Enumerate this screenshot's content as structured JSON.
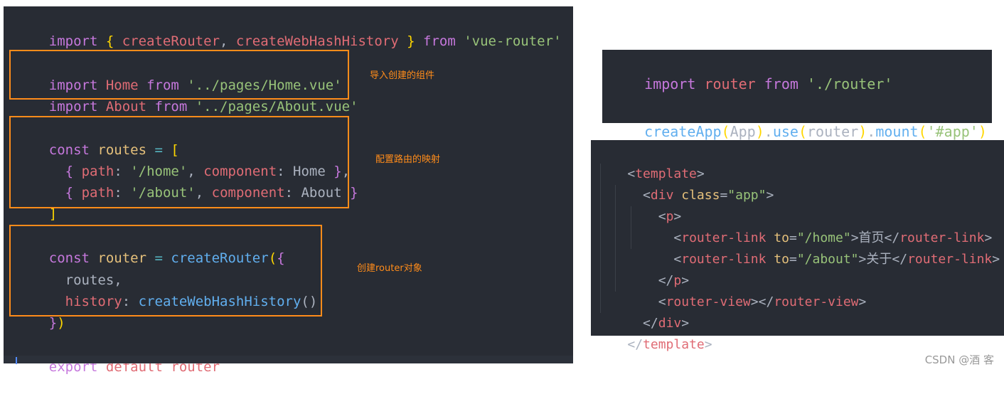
{
  "router_file": {
    "lines": {
      "import_vue_router": [
        "import",
        " { ",
        "createRouter",
        ", ",
        "createWebHashHistory",
        " } ",
        "from",
        " ",
        "'vue-router'"
      ],
      "import_home": [
        "import",
        " ",
        "Home",
        " ",
        "from",
        " ",
        "'../pages/Home.vue'"
      ],
      "import_about": [
        "import",
        " ",
        "About",
        " ",
        "from",
        " ",
        "'../pages/About.vue'"
      ],
      "routes_open": [
        "const",
        " ",
        "routes",
        " ",
        "=",
        " ",
        "["
      ],
      "route_home": [
        "  ",
        "{",
        " ",
        "path",
        ": ",
        "'/home'",
        ", ",
        "component",
        ": ",
        "Home",
        " ",
        "}",
        ","
      ],
      "route_about": [
        "  ",
        "{",
        " ",
        "path",
        ": ",
        "'/about'",
        ", ",
        "component",
        ": ",
        "About",
        " ",
        "}"
      ],
      "routes_close": [
        "]"
      ],
      "router_open": [
        "const",
        " ",
        "router",
        " ",
        "=",
        " ",
        "createRouter",
        "(",
        "{"
      ],
      "router_routes": [
        "  ",
        "routes",
        ","
      ],
      "router_history": [
        "  ",
        "history",
        ": ",
        "createWebHashHistory",
        "()"
      ],
      "router_close": [
        "}",
        ")"
      ],
      "export": [
        "export",
        " ",
        "default",
        " ",
        "router"
      ]
    },
    "annotations": {
      "imports": "导入创建的组件",
      "routes": "配置路由的映射",
      "router": "创建router对象"
    }
  },
  "main_file": {
    "lines": {
      "import_router": [
        "import",
        " ",
        "router",
        " ",
        "from",
        " ",
        "'./router'"
      ],
      "create_app": [
        "createApp",
        "(",
        "App",
        ")",
        ".",
        "use",
        "(",
        "router",
        ")",
        ".",
        "mount",
        "(",
        "'#app'",
        ")"
      ]
    }
  },
  "app_template": {
    "lines": {
      "template_open": [
        "<",
        "template",
        ">"
      ],
      "div_open": [
        "  ",
        "<",
        "div",
        " ",
        "class",
        "=",
        "\"app\"",
        ">"
      ],
      "p_open": [
        "    ",
        "<",
        "p",
        ">"
      ],
      "link_home": [
        "      ",
        "<",
        "router-link",
        " ",
        "to",
        "=",
        "\"/home\"",
        ">",
        "首页",
        "</",
        "router-link",
        ">"
      ],
      "link_about": [
        "      ",
        "<",
        "router-link",
        " ",
        "to",
        "=",
        "\"/about\"",
        ">",
        "关于",
        "</",
        "router-link",
        ">"
      ],
      "p_close": [
        "    ",
        "</",
        "p",
        ">"
      ],
      "router_view": [
        "    ",
        "<",
        "router-view",
        ">",
        "</",
        "router-view",
        ">"
      ],
      "div_close": [
        "  ",
        "</",
        "div",
        ">"
      ],
      "template_close": [
        "</",
        "template",
        ">"
      ]
    }
  },
  "watermark": "CSDN @酒 客",
  "colors": {
    "editor_bg": "#282c34",
    "highlight_box": "#ff8c1a",
    "keyword": "#c678dd",
    "variable": "#e06c75",
    "string": "#98c379",
    "function": "#61afef"
  }
}
